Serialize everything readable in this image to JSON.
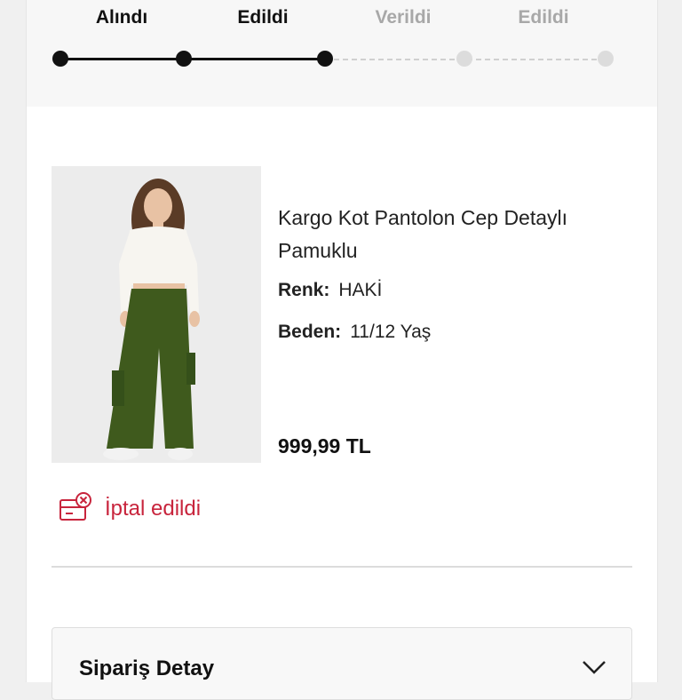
{
  "tracker": {
    "steps": [
      {
        "label": "Alındı",
        "status": "done"
      },
      {
        "label": "Edildi",
        "status": "done"
      },
      {
        "label": "Verildi",
        "status": "todo"
      },
      {
        "label": "Edildi",
        "status": "todo"
      }
    ]
  },
  "product": {
    "title": "Kargo Kot Pantolon Cep Detaylı Pamuklu",
    "color_label": "Renk:",
    "color_value": "HAKİ",
    "size_label": "Beden:",
    "size_value": "11/12 Yaş",
    "price": "999,99 TL"
  },
  "status": {
    "text": "İptal edildi",
    "icon": "cancelled-box-icon",
    "color": "#c8243c"
  },
  "order_detail": {
    "title": "Sipariş Detay",
    "icon": "chevron-down-icon"
  }
}
